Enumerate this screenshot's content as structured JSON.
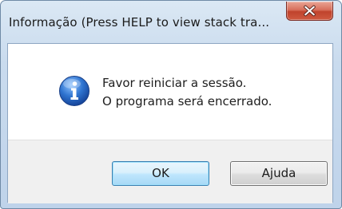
{
  "window": {
    "title": "Informação (Press HELP to view stack tra..."
  },
  "message": {
    "line1": "Favor reiniciar a sessão.",
    "line2": "O programa será encerrado.",
    "icon": "information-icon"
  },
  "buttons": {
    "ok_label": "OK",
    "help_label": "Ajuda"
  },
  "colors": {
    "titlebar": "#c9dbee",
    "close_button": "#c7472f",
    "info_icon": "#1f5fbf",
    "ok_button_border": "#3c7fb1",
    "footer": "#f0f0f0"
  }
}
